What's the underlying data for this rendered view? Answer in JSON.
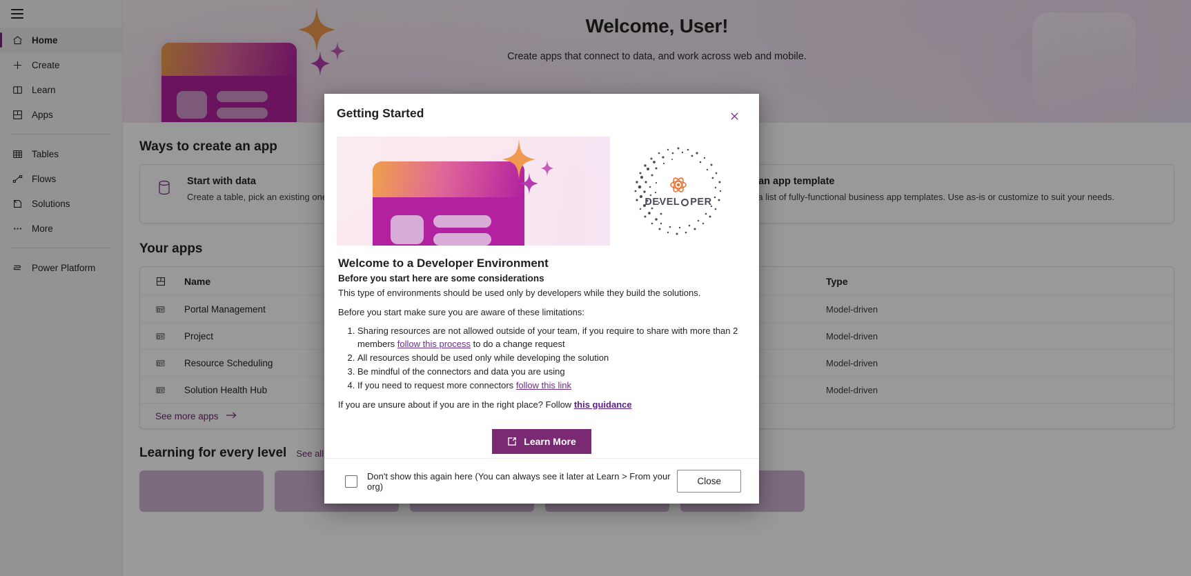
{
  "sidebar": {
    "menu_icon": "hamburger-icon",
    "items": [
      {
        "label": "Home",
        "icon": "home-icon",
        "selected": true
      },
      {
        "label": "Create",
        "icon": "plus-icon",
        "selected": false
      },
      {
        "label": "Learn",
        "icon": "book-icon",
        "selected": false
      },
      {
        "label": "Apps",
        "icon": "apps-grid-icon",
        "selected": false
      },
      {
        "label": "Tables",
        "icon": "table-icon",
        "selected": false
      },
      {
        "label": "Flows",
        "icon": "flow-icon",
        "selected": false
      },
      {
        "label": "Solutions",
        "icon": "solutions-icon",
        "selected": false
      },
      {
        "label": "More",
        "icon": "ellipsis-icon",
        "selected": false
      },
      {
        "label": "Power Platform",
        "icon": "power-platform-icon",
        "selected": false
      }
    ]
  },
  "hero": {
    "title": "Welcome, User!",
    "subtitle": "Create apps that connect to data, and work across web and mobile."
  },
  "ways": {
    "section_title": "Ways to create an app",
    "cards": [
      {
        "title": "Start with data",
        "desc": "Create a table, pick an existing one, or import data from Excel to create an app.",
        "icon": "database-icon"
      },
      {
        "title": "Start with an app template",
        "desc": "Select from a list of fully-functional business app templates. Use as-is or customize to suit your needs.",
        "icon": "app-template-icon"
      }
    ]
  },
  "your_apps": {
    "section_title": "Your apps",
    "columns": [
      "Name",
      "Type"
    ],
    "header_icon": "apps-grid-icon",
    "rows": [
      {
        "name": "Portal Management",
        "type": "Model-driven",
        "icon": "model-driven-icon"
      },
      {
        "name": "Project",
        "type": "Model-driven",
        "icon": "model-driven-icon"
      },
      {
        "name": "Resource Scheduling",
        "type": "Model-driven",
        "icon": "model-driven-icon"
      },
      {
        "name": "Solution Health Hub",
        "type": "Model-driven",
        "icon": "model-driven-icon"
      }
    ],
    "see_more_label": "See more apps",
    "see_more_icon": "arrow-right-icon"
  },
  "learning": {
    "section_title": "Learning for every level",
    "see_all_label": "See all"
  },
  "modal": {
    "title": "Getting Started",
    "close_icon": "close-icon",
    "badge": {
      "word_left": "DEVEL",
      "word_right": "PER",
      "flower_icon": "atom-flower-icon"
    },
    "heading": "Welcome to a Developer Environment",
    "subheading": "Before you start here are some considerations",
    "paragraph1": "This type of environments should be used only by developers while they build the solutions.",
    "paragraph2": "Before you start make sure you are aware of these limitations:",
    "list": [
      {
        "pre": "Sharing resources are not allowed outside of your team, if you require to share with more than 2 members ",
        "link": "follow this process",
        "post": " to do a change request"
      },
      {
        "pre": "All resources should be used only while developing the solution",
        "link": "",
        "post": ""
      },
      {
        "pre": "Be mindful of the connectors and data you are using",
        "link": "",
        "post": ""
      },
      {
        "pre": "If you need to request more connectors ",
        "link": "follow this link",
        "post": ""
      }
    ],
    "closing_pre": "If you are unsure about if you are in the right place? Follow ",
    "closing_link": "this guidance",
    "learn_more_label": "Learn More",
    "learn_more_icon": "external-link-icon",
    "checkbox_label": "Don't show this again here (You can always see it later at Learn > From your org)",
    "checkbox_checked": false,
    "close_label": "Close"
  },
  "colors": {
    "accent": "#742774",
    "button": "#7a2a72",
    "link": "#6b2d8f"
  }
}
